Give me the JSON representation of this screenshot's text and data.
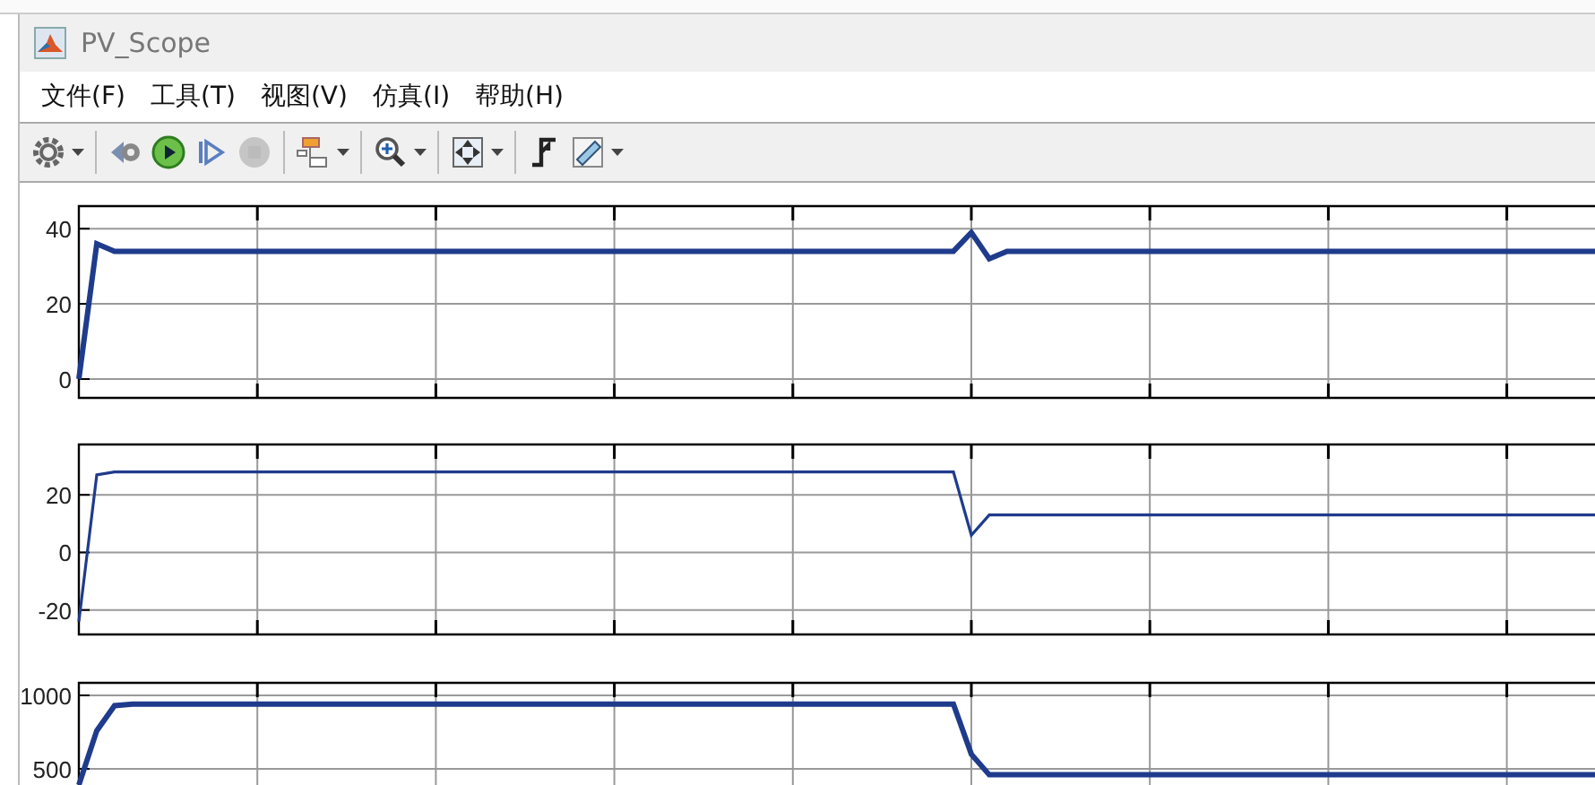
{
  "window": {
    "title": "PV_Scope"
  },
  "menu": [
    {
      "label": "文件(F)"
    },
    {
      "label": "工具(T)"
    },
    {
      "label": "视图(V)"
    },
    {
      "label": "仿真(I)"
    },
    {
      "label": "帮助(H)"
    }
  ],
  "toolbar": [
    {
      "buttons": [
        {
          "kind": "settings",
          "has_menu": true,
          "disabled": false
        }
      ]
    },
    {
      "buttons": [
        {
          "kind": "step-back",
          "has_menu": false,
          "disabled": false
        },
        {
          "kind": "run",
          "has_menu": false,
          "disabled": false
        },
        {
          "kind": "step-forward",
          "has_menu": false,
          "disabled": false
        },
        {
          "kind": "stop",
          "has_menu": false,
          "disabled": true
        }
      ]
    },
    {
      "buttons": [
        {
          "kind": "highlight",
          "has_menu": true,
          "disabled": false
        }
      ]
    },
    {
      "buttons": [
        {
          "kind": "zoom",
          "has_menu": true,
          "disabled": false
        }
      ]
    },
    {
      "buttons": [
        {
          "kind": "fit",
          "has_menu": true,
          "disabled": false
        }
      ]
    },
    {
      "buttons": [
        {
          "kind": "trigger",
          "has_menu": false,
          "disabled": false
        },
        {
          "kind": "measure",
          "has_menu": true,
          "disabled": false
        }
      ]
    }
  ],
  "plots": [
    {
      "chart_data": {
        "type": "line",
        "grid": true,
        "ylim": [
          -5,
          46
        ],
        "yticks": [
          0,
          20,
          40
        ],
        "categories": [
          null,
          null,
          null,
          null,
          null,
          null,
          null,
          null,
          null,
          null,
          null,
          null,
          null,
          null,
          null,
          null,
          null,
          null,
          null,
          null,
          null,
          null,
          null,
          null,
          null,
          null,
          null,
          null,
          null,
          null,
          null,
          null,
          null,
          null,
          null,
          null,
          null,
          null,
          null,
          null,
          null,
          null,
          null,
          null,
          null,
          null,
          null,
          null,
          null,
          null,
          null,
          null,
          null,
          null,
          null,
          null,
          null,
          null,
          null,
          null,
          null,
          null,
          null,
          null,
          null,
          null,
          null,
          null,
          null,
          null,
          null,
          null,
          null,
          null,
          null,
          null,
          null,
          null,
          null,
          null,
          null,
          null,
          null,
          null,
          null,
          null
        ],
        "series": [
          {
            "color": "#1f3b8c",
            "values": [
              0,
              36,
              34,
              34,
              34,
              34,
              34,
              34,
              34,
              34,
              34,
              34,
              34,
              34,
              34,
              34,
              34,
              34,
              34,
              34,
              34,
              34,
              34,
              34,
              34,
              34,
              34,
              34,
              34,
              34,
              34,
              34,
              34,
              34,
              34,
              34,
              34,
              34,
              34,
              34,
              34,
              34,
              34,
              34,
              34,
              34,
              34,
              34,
              34,
              34,
              39,
              32,
              34,
              34,
              34,
              34,
              34,
              34,
              34,
              34,
              34,
              34,
              34,
              34,
              34,
              34,
              34,
              34,
              34,
              34,
              34,
              34,
              34,
              34,
              34,
              34,
              34,
              34,
              34,
              34,
              34,
              34,
              34,
              34,
              34,
              34
            ]
          }
        ]
      }
    },
    {
      "chart_data": {
        "type": "line",
        "grid": true,
        "ylim": [
          -28.5,
          37.5
        ],
        "yticks": [
          -20,
          0,
          20
        ],
        "categories": [
          null,
          null,
          null,
          null,
          null,
          null,
          null,
          null,
          null,
          null,
          null,
          null,
          null,
          null,
          null,
          null,
          null,
          null,
          null,
          null,
          null,
          null,
          null,
          null,
          null,
          null,
          null,
          null,
          null,
          null,
          null,
          null,
          null,
          null,
          null,
          null,
          null,
          null,
          null,
          null,
          null,
          null,
          null,
          null,
          null,
          null,
          null,
          null,
          null,
          null,
          null,
          null,
          null,
          null,
          null,
          null,
          null,
          null,
          null,
          null,
          null,
          null,
          null,
          null,
          null,
          null,
          null,
          null,
          null,
          null,
          null,
          null,
          null,
          null,
          null,
          null,
          null,
          null,
          null,
          null,
          null,
          null,
          null,
          null,
          null,
          null
        ],
        "series": [
          {
            "color": "#1f3b8c",
            "values": [
              -24,
              27,
              28,
              28,
              28,
              28,
              28,
              28,
              28,
              28,
              28,
              28,
              28,
              28,
              28,
              28,
              28,
              28,
              28,
              28,
              28,
              28,
              28,
              28,
              28,
              28,
              28,
              28,
              28,
              28,
              28,
              28,
              28,
              28,
              28,
              28,
              28,
              28,
              28,
              28,
              28,
              28,
              28,
              28,
              28,
              28,
              28,
              28,
              28,
              28,
              6,
              13,
              13,
              13,
              13,
              13,
              13,
              13,
              13,
              13,
              13,
              13,
              13,
              13,
              13,
              13,
              13,
              13,
              13,
              13,
              13,
              13,
              13,
              13,
              13,
              13,
              13,
              13,
              13,
              13,
              13,
              13,
              13,
              13,
              13,
              13
            ]
          }
        ]
      }
    },
    {
      "chart_data": {
        "type": "line",
        "grid": true,
        "ylim": [
          390,
          1085
        ],
        "yticks": [
          500,
          1000
        ],
        "categories": [
          null,
          null,
          null,
          null,
          null,
          null,
          null,
          null,
          null,
          null,
          null,
          null,
          null,
          null,
          null,
          null,
          null,
          null,
          null,
          null,
          null,
          null,
          null,
          null,
          null,
          null,
          null,
          null,
          null,
          null,
          null,
          null,
          null,
          null,
          null,
          null,
          null,
          null,
          null,
          null,
          null,
          null,
          null,
          null,
          null,
          null,
          null,
          null,
          null,
          null,
          null,
          null,
          null,
          null,
          null,
          null,
          null,
          null,
          null,
          null,
          null,
          null,
          null,
          null,
          null,
          null,
          null,
          null,
          null,
          null,
          null,
          null,
          null,
          null,
          null,
          null,
          null,
          null,
          null,
          null,
          null,
          null,
          null,
          null,
          null,
          null
        ],
        "series": [
          {
            "color": "#1f3b8c",
            "values": [
              390,
              760,
              930,
              940,
              940,
              940,
              940,
              940,
              940,
              940,
              940,
              940,
              940,
              940,
              940,
              940,
              940,
              940,
              940,
              940,
              940,
              940,
              940,
              940,
              940,
              940,
              940,
              940,
              940,
              940,
              940,
              940,
              940,
              940,
              940,
              940,
              940,
              940,
              940,
              940,
              940,
              940,
              940,
              940,
              940,
              940,
              940,
              940,
              940,
              940,
              600,
              460,
              460,
              460,
              460,
              460,
              460,
              460,
              460,
              460,
              460,
              460,
              460,
              460,
              460,
              460,
              460,
              460,
              460,
              460,
              460,
              460,
              460,
              460,
              460,
              460,
              460,
              460,
              460,
              460,
              460,
              460,
              460,
              460,
              460,
              460
            ]
          }
        ]
      }
    }
  ]
}
